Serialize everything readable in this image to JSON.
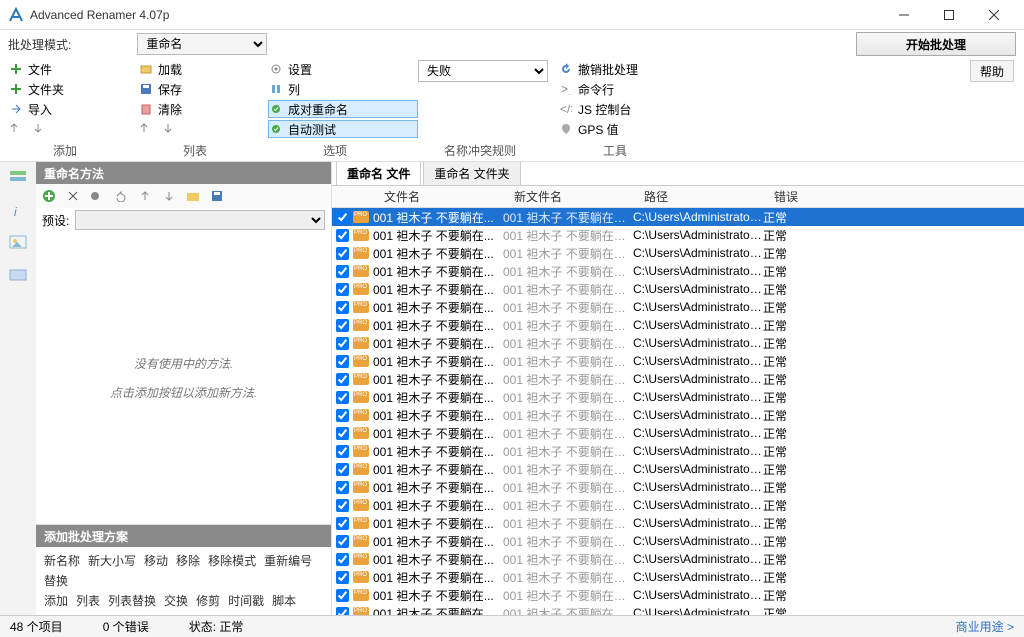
{
  "title": "Advanced Renamer 4.07p",
  "batch_mode_label": "批处理模式:",
  "batch_mode_value": "重命名",
  "start_button": "开始批处理",
  "help_button": "帮助",
  "menu": {
    "col1": [
      "文件",
      "文件夹",
      "导入"
    ],
    "col2": [
      "加载",
      "保存",
      "清除"
    ],
    "col3": [
      "设置",
      "列",
      "成对重命名",
      "自动测试"
    ],
    "col4_select": "失败",
    "col5": [
      "撤销批处理",
      "命令行",
      "JS 控制台",
      "GPS 值"
    ]
  },
  "sections": {
    "add": "添加",
    "list": "列表",
    "options": "选项",
    "collision": "名称冲突规则",
    "tools": "工具"
  },
  "left": {
    "header": "重命名方法",
    "preset_label": "预设:",
    "empty1": "没有使用中的方法.",
    "empty2": "点击添加按钮以添加新方法.",
    "scheme_header": "添加批处理方案",
    "scheme_row1": [
      "新名称",
      "新大小写",
      "移动",
      "移除",
      "移除模式",
      "重新编号",
      "替换"
    ],
    "scheme_row2": [
      "添加",
      "列表",
      "列表替换",
      "交换",
      "修剪",
      "时间戳",
      "脚本"
    ]
  },
  "tabs": {
    "files": "重命名 文件",
    "folders": "重命名 文件夹"
  },
  "columns": {
    "name": "文件名",
    "newname": "新文件名",
    "path": "路径",
    "error": "错误"
  },
  "row": {
    "name": "001 袒木子 不要躺在...",
    "newname": "001 袒木子 不要躺在课桌...",
    "path": "C:\\Users\\Administrator\\...",
    "error": "正常"
  },
  "row_count": 24,
  "status": {
    "items": "48 个项目",
    "errors": "0 个错误",
    "state_label": "状态:",
    "state_value": "正常",
    "link": "商业用途 >"
  }
}
